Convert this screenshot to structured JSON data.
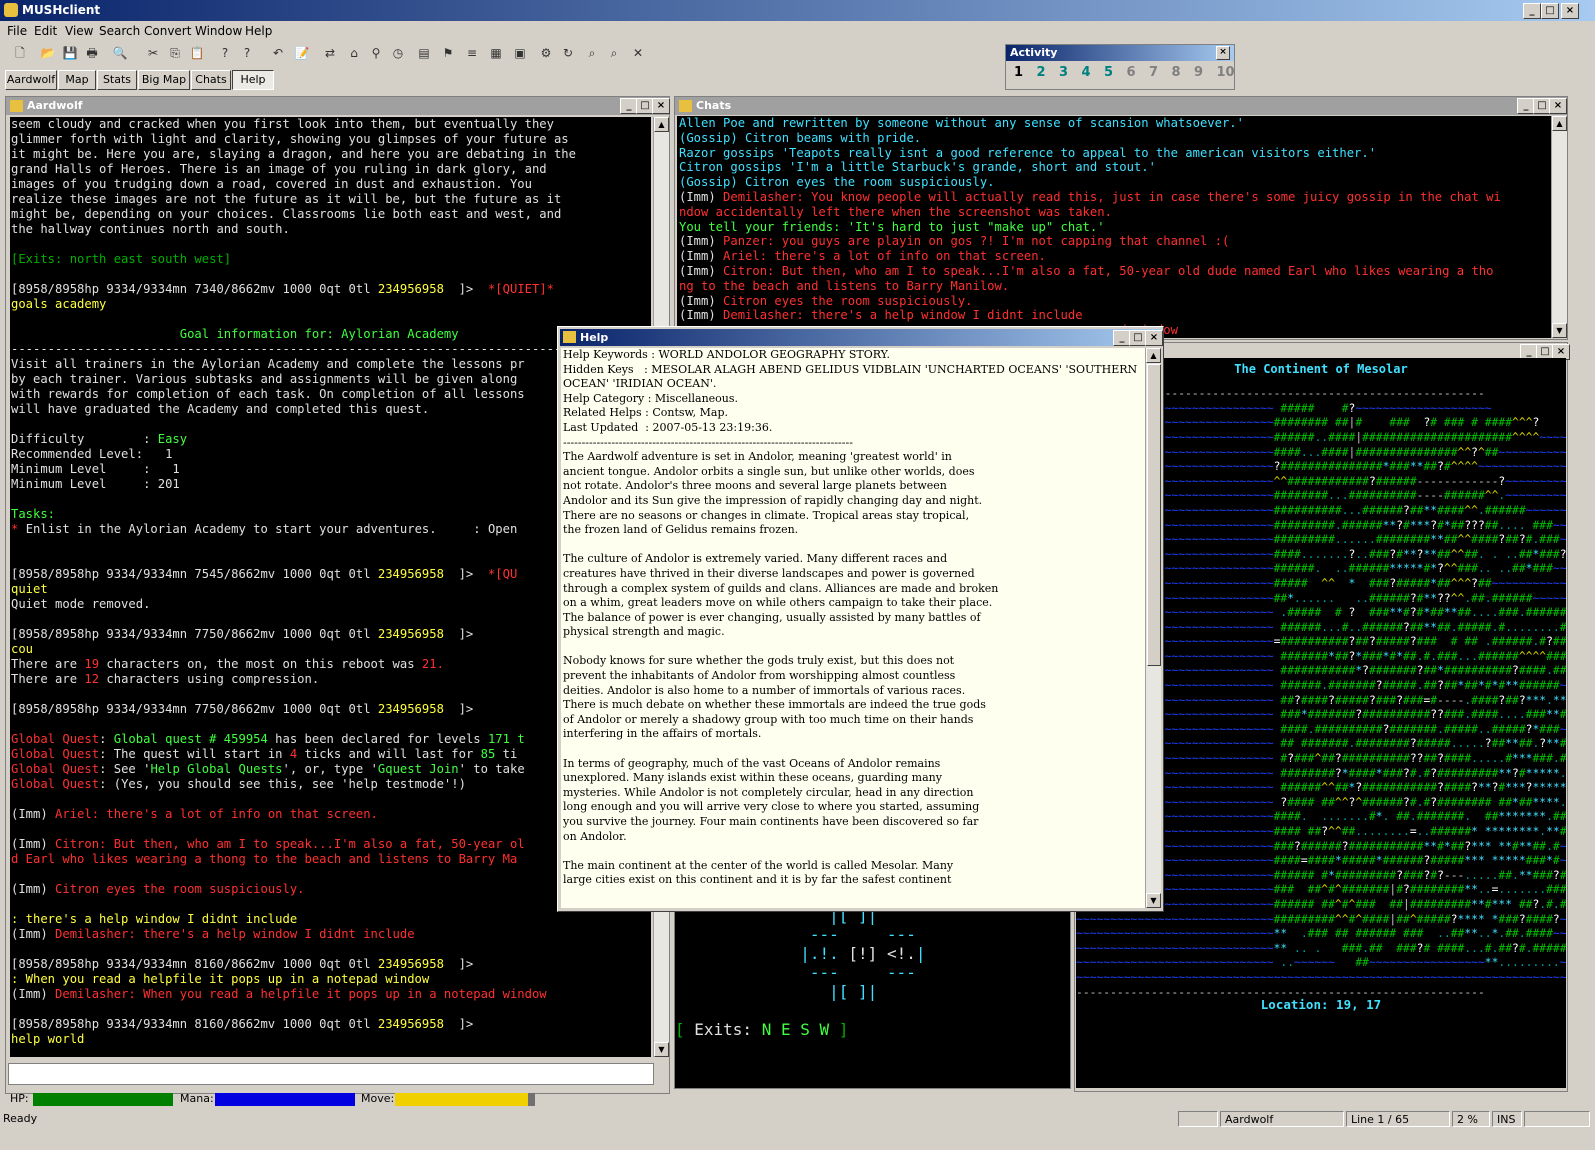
{
  "app": {
    "title": "MUSHclient"
  },
  "menu": [
    "File",
    "Edit",
    "View",
    "Search",
    "Convert",
    "Window",
    "Help"
  ],
  "toolbar": {
    "icons": [
      "new-icon",
      "open-icon",
      "save-icon",
      "print-icon",
      "print-preview-icon",
      "cut-icon",
      "copy-icon",
      "paste-icon",
      "help-icon",
      "context-help-icon",
      "undo-icon",
      "notepad-icon",
      "connect-icon",
      "world-icon",
      "link-icon",
      "timer-icon",
      "log-icon",
      "triggers-icon",
      "aliases-icon",
      "variables-icon",
      "plugins-icon",
      "scripts-icon",
      "reload-icon",
      "find-icon",
      "find-again-icon",
      "quit-icon"
    ]
  },
  "tabs": [
    "Aardwolf",
    "Map",
    "Stats",
    "Big Map",
    "Chats",
    "Help"
  ],
  "activity": {
    "title": "Activity",
    "numbers": [
      "1",
      "2",
      "3",
      "4",
      "5",
      "6",
      "7",
      "8",
      "9",
      "10"
    ]
  },
  "aardwolf_window": {
    "title": "Aardwolf"
  },
  "chats_window": {
    "title": "Chats"
  },
  "help_window": {
    "title": "Help"
  },
  "map_window": {
    "title": "The Continent of Mesolar",
    "location": "Location: 19, 17"
  },
  "roommap": {
    "exits_label": "[ Exits: ",
    "exits": "N E S W",
    "close": " ]"
  },
  "gauges": {
    "hp_label": "HP:",
    "mana_label": "Mana:",
    "move_label": "Move:",
    "hp": 1.0,
    "mana": 1.0,
    "move": 0.95
  },
  "statusbar": {
    "ready": "Ready",
    "world": "Aardwolf",
    "line": "Line 1 / 65",
    "percent": "2 %",
    "ins": "INS"
  },
  "main_lines": [
    [
      [
        "w",
        "seem cloudy and cracked when you first look into them, but eventually they"
      ]
    ],
    [
      [
        "w",
        "glimmer forth with light and clarity, showing you glimpses of your future as"
      ]
    ],
    [
      [
        "w",
        "it might be. Here you are, slaying a dragon, and here you are debating in the"
      ]
    ],
    [
      [
        "w",
        "grand Halls of Heroes. There is an image of you ruling in dark glory, and"
      ]
    ],
    [
      [
        "w",
        "images of you trudging down a road, covered in dust and exhaustion. You"
      ]
    ],
    [
      [
        "w",
        "realize these images are not the future as it will be, but the future as it"
      ]
    ],
    [
      [
        "w",
        "might be, depending on your choices. Classrooms lie both east and west, and"
      ]
    ],
    [
      [
        "w",
        "the hallway continues north and south."
      ]
    ],
    [
      [
        "w",
        ""
      ]
    ],
    [
      [
        "dg",
        "[Exits: north east south west]"
      ]
    ],
    [
      [
        "w",
        ""
      ]
    ],
    [
      [
        "w",
        "[8958/8958hp 9334/9334mn 7340/8662mv 1000 0qt 0tl "
      ],
      [
        "y",
        "234956958"
      ],
      [
        "w",
        "  ]>  "
      ],
      [
        "r",
        "*[QUIET]*"
      ]
    ],
    [
      [
        "y",
        "goals academy"
      ]
    ],
    [
      [
        "w",
        ""
      ]
    ],
    [
      [
        "g",
        "                       Goal information for: Aylorian Academy"
      ]
    ],
    [
      [
        "w",
        "------------------------------------------------------------------------------"
      ]
    ],
    [
      [
        "w",
        "Visit all trainers in the Aylorian Academy and complete the lessons pr"
      ]
    ],
    [
      [
        "w",
        "by each trainer. Various subtasks and assignments will be given along"
      ]
    ],
    [
      [
        "w",
        "with rewards for completion of each task. On completion of all lessons"
      ]
    ],
    [
      [
        "w",
        "will have graduated the Academy and completed this quest."
      ]
    ],
    [
      [
        "w",
        ""
      ]
    ],
    [
      [
        "w",
        "Difficulty        : "
      ],
      [
        "g",
        "Easy"
      ]
    ],
    [
      [
        "w",
        "Recommended Level:   1"
      ]
    ],
    [
      [
        "w",
        "Minimum Level     :   1"
      ]
    ],
    [
      [
        "w",
        "Minimum Level     : 201"
      ]
    ],
    [
      [
        "w",
        ""
      ]
    ],
    [
      [
        "g",
        "Tasks:"
      ]
    ],
    [
      [
        "r",
        "* "
      ],
      [
        "w",
        "Enlist in the Aylorian Academy to start your adventures.     : Open"
      ]
    ],
    [
      [
        "w",
        ""
      ]
    ],
    [
      [
        "w",
        ""
      ]
    ],
    [
      [
        "w",
        "[8958/8958hp 9334/9334mn 7545/8662mv 1000 0qt 0tl "
      ],
      [
        "y",
        "234956958"
      ],
      [
        "w",
        "  ]>  "
      ],
      [
        "r",
        "*[QU"
      ]
    ],
    [
      [
        "y",
        "quiet"
      ]
    ],
    [
      [
        "w",
        "Quiet mode removed."
      ]
    ],
    [
      [
        "w",
        ""
      ]
    ],
    [
      [
        "w",
        "[8958/8958hp 9334/9334mn 7750/8662mv 1000 0qt 0tl "
      ],
      [
        "y",
        "234956958"
      ],
      [
        "w",
        "  ]>"
      ]
    ],
    [
      [
        "y",
        "cou"
      ]
    ],
    [
      [
        "w",
        "There are "
      ],
      [
        "r",
        "19"
      ],
      [
        "w",
        " characters on, the most on this reboot was "
      ],
      [
        "r",
        "21."
      ]
    ],
    [
      [
        "w",
        "There are "
      ],
      [
        "r",
        "12"
      ],
      [
        "w",
        " characters using compression."
      ]
    ],
    [
      [
        "w",
        ""
      ]
    ],
    [
      [
        "w",
        "[8958/8958hp 9334/9334mn 7750/8662mv 1000 0qt 0tl "
      ],
      [
        "y",
        "234956958"
      ],
      [
        "w",
        "  ]>"
      ]
    ],
    [
      [
        "w",
        ""
      ]
    ],
    [
      [
        "r",
        "Global Quest"
      ],
      [
        "w",
        ": "
      ],
      [
        "g",
        "Global quest # 459954"
      ],
      [
        "w",
        " has been declared for levels "
      ],
      [
        "g",
        "171 t"
      ]
    ],
    [
      [
        "r",
        "Global Quest"
      ],
      [
        "w",
        ": The quest will start in "
      ],
      [
        "r",
        "4"
      ],
      [
        "w",
        " ticks and will last for "
      ],
      [
        "g",
        "85"
      ],
      [
        "w",
        " ti"
      ]
    ],
    [
      [
        "r",
        "Global Quest"
      ],
      [
        "w",
        ": See '"
      ],
      [
        "g",
        "Help Global Quests"
      ],
      [
        "w",
        "', or, type '"
      ],
      [
        "g",
        "Gquest Join"
      ],
      [
        "w",
        "' to take"
      ]
    ],
    [
      [
        "r",
        "Global Quest"
      ],
      [
        "w",
        ": (Yes, you should see this, see 'help testmode'!)"
      ]
    ],
    [
      [
        "w",
        ""
      ]
    ],
    [
      [
        "w",
        "("
      ],
      [
        "w",
        "Imm"
      ],
      [
        "w",
        ") "
      ],
      [
        "r",
        "Ariel: there's a lot of info on that screen."
      ]
    ],
    [
      [
        "w",
        ""
      ]
    ],
    [
      [
        "w",
        "(Imm) "
      ],
      [
        "r",
        "Citron: But then, who am I to speak...I'm also a fat, 50-year ol"
      ]
    ],
    [
      [
        "r",
        "d Earl who likes wearing a thong to the beach and listens to Barry Ma"
      ]
    ],
    [
      [
        "w",
        ""
      ]
    ],
    [
      [
        "w",
        "(Imm) "
      ],
      [
        "r",
        "Citron eyes the room suspiciously."
      ]
    ],
    [
      [
        "w",
        ""
      ]
    ],
    [
      [
        "y",
        ": there's a help window I didnt include"
      ]
    ],
    [
      [
        "w",
        "(Imm) "
      ],
      [
        "r",
        "Demilasher: there's a help window I didnt include"
      ]
    ],
    [
      [
        "w",
        ""
      ]
    ],
    [
      [
        "w",
        "[8958/8958hp 9334/9334mn 8160/8662mv 1000 0qt 0tl "
      ],
      [
        "y",
        "234956958"
      ],
      [
        "w",
        "  ]>"
      ]
    ],
    [
      [
        "y",
        ": When you read a helpfile it pops up in a notepad window"
      ]
    ],
    [
      [
        "w",
        "(Imm) "
      ],
      [
        "r",
        "Demilasher: When you read a helpfile it pops up in a notepad window"
      ]
    ],
    [
      [
        "w",
        ""
      ]
    ],
    [
      [
        "w",
        "[8958/8958hp 9334/9334mn 8160/8662mv 1000 0qt 0tl "
      ],
      [
        "y",
        "234956958"
      ],
      [
        "w",
        "  ]>"
      ]
    ],
    [
      [
        "y",
        "help world"
      ]
    ],
    [
      [
        "w",
        ""
      ]
    ],
    [
      [
        "w",
        "[8958/8958hp 9334/9334mn 8160/8662mv 1000 0qt 0tl "
      ],
      [
        "y",
        "234956958"
      ],
      [
        "w",
        "  ]>"
      ]
    ]
  ],
  "chat_lines": [
    [
      [
        "c",
        "Allen Poe and rewritten by someone without any sense of scansion whatsoever.'"
      ]
    ],
    [
      [
        "c",
        "(Gossip) Citron beams with pride."
      ]
    ],
    [
      [
        "c",
        "Razor gossips 'Teapots really isnt a good reference to appeal to the american visitors either.'"
      ]
    ],
    [
      [
        "c",
        "Citron gossips 'I'm a little Starbuck's grande, short and stout.'"
      ]
    ],
    [
      [
        "c",
        "(Gossip) Citron eyes the room suspiciously."
      ]
    ],
    [
      [
        "w",
        "("
      ],
      [
        "w",
        "Imm"
      ],
      [
        "w",
        ") "
      ],
      [
        "r",
        "Demilasher: You know people will actually read this, just in case there's some juicy gossip in the chat wi"
      ]
    ],
    [
      [
        "r",
        "ndow accidentally left there when the screenshot was taken."
      ]
    ],
    [
      [
        "g",
        "You tell your friends: 'It's hard to just \"make up\" chat.'"
      ]
    ],
    [
      [
        "w",
        "(Imm) "
      ],
      [
        "r",
        "Panzer: you guys are playin on gos ?! I'm not capping that channel :("
      ]
    ],
    [
      [
        "w",
        "(Imm) "
      ],
      [
        "r",
        "Ariel: there's a lot of info on that screen."
      ]
    ],
    [
      [
        "w",
        "(Imm) "
      ],
      [
        "r",
        "Citron: But then, who am I to speak...I'm also a fat, 50-year old dude named Earl who likes wearing a tho"
      ]
    ],
    [
      [
        "r",
        "ng to the beach and listens to Barry Manilow."
      ]
    ],
    [
      [
        "w",
        "(Imm) "
      ],
      [
        "r",
        "Citron eyes the room suspiciously."
      ]
    ],
    [
      [
        "w",
        "(Imm) "
      ],
      [
        "r",
        "Demilasher: there's a help window I didnt include"
      ]
    ],
    [
      [
        "r",
        "                                                          pad window"
      ]
    ]
  ],
  "help_lines": [
    "Help Keywords : WORLD ANDOLOR GEOGRAPHY STORY.",
    "Hidden Keys   : MESOLAR ALAGH ABEND GELIDUS VIDBLAIN 'UNCHARTED OCEANS' 'SOUTHERN",
    "OCEAN' 'IRIDIAN OCEAN'.",
    "Help Category : Miscellaneous.",
    "Related Helps : Contsw, Map.",
    "Last Updated  : 2007-05-13 23:19:36.",
    "------------------------------------------------------------------------------",
    "The Aardwolf adventure is set in Andolor, meaning 'greatest world' in",
    "ancient tongue. Andolor orbits a single sun, but unlike other worlds, does",
    "not rotate. Andolor's three moons and several large planets between",
    "Andolor and its Sun give the impression of rapidly changing day and night.",
    "There are no seasons or changes in climate. Tropical areas stay tropical,",
    "the frozen land of Gelidus remains frozen.",
    "",
    "The culture of Andolor is extremely varied. Many different races and",
    "creatures have thrived in their diverse landscapes and power is governed",
    "through a complex system of guilds and clans. Alliances are made and broken",
    "on a whim, great leaders move on while others campaign to take their place.",
    "The balance of power is ever changing, usually assisted by many battles of",
    "physical strength and magic.",
    "",
    "Nobody knows for sure whether the gods truly exist, but this does not",
    "prevent the inhabitants of Andolor from worshipping almost countless",
    "deities. Andolor is also home to a number of immortals of various races.",
    "There is much debate on whether these immortals are indeed the true gods",
    "of Andolor or merely a shadowy group with too much time on their hands",
    "interfering in the affairs of mortals.",
    "",
    "In terms of geography, much of the vast Oceans of Andolor remains",
    "unexplored. Many islands exist within these oceans, guarding many",
    "mysteries. While Andolor is not completely circular, head in any direction",
    "long enough and you will arrive very close to where you started, assuming",
    "you survive the journey. Four main continents have been discovered so far",
    "on Andolor.",
    "",
    "The main continent at the center of the world is called Mesolar. Many",
    "large cities exist on this continent and it is by far the safest continent"
  ],
  "map_lines": [
    "------------------------------------------------------------",
    "~~~~~~~~~~~~~~~~~~~~~~~~~~~~~ #####    #?~~~~~~~~~~~~~~~~~~~~",
    "~~~~~~~~~~~~~~~~~~~~~~~~~~~~~######## ##|#    ###  ?# ### # ####^^^?       ?",
    "~~~~~~~~~~~~~~~~~~~~~~~~~~~~~######..####|######################^^^^~~~~~~~~",
    "~~~~~~~~~~~~~~~~~~~~~~~~~~~~~####...####|###############^^?^##~~~~~~~~~~~~~~",
    "~~~~~~~~~~~~~~~~~~~~~~~~~~~~~?###############*###**##?#^^^^~~~~~~~~~~~~~~~~~",
    "~~~~~~~~~~~~~~~~~~~~~~~~~~~~~^^############?######------------?~~~~~~~~~~~~",
    "~~~~~~~~~~~~~~~~~~~~~~~~~~~~~########...##########----######^^.~~~~~~~~~~~~",
    "~~~~~~~~~~~~~~~~~~~~~~~~~~~~~##########...######?##**####^^.######~~~~~~~~~",
    "~~~~~~~~~~~~~~~~~~~~~~~~~~~~~#########.######**?#***?#*##???##.... ###~~~~~",
    "~~~~~~~~~~~~~~~~~~~~~~~~~~~~~#########......########**##^^####?##?#.###~~~~",
    "~~~~~~~~~~~~~~~~~~~~~~~~~~~~~####.......?..###?#**?**##^^##. . ..##*###?~~~",
    "~~~~~~~~~~~~~~~~~~~~~~~~~~~~~######.  ..######*****#*?^^###.. ..##*###~~~~~",
    "~~~~~~~~~~~~~~~~~~~~~~~~~~~~~#####  ^^  *  ###?#####*##^^^?##~~~~~~~~~~~~~~",
    "~~~~~~~~~~~~~~~~~~~~~~~~~~~~~##*......   ..######?#**??^^.##.######~~~~~~~~",
    "~~~~~~~~~~~~~~~~~~~~~~~~~~~~~ .#####  # ?  ###**#?#*##**##....###.#########",
    "~~~~~~~~~~~~~~~~~~~~~~~~~~~~~ ######...#..######?##**##.#####.#........####",
    "~~~~~~~~~~~~~~~~~~~~~~~~~~~~~=##########?##?#####?###  # ## .######.#?##^~~",
    "~~~~~~~~~~~~~~~~~~~~~~~~~~~~~ #######*##?*###*#*##.#.###...######^^^^####~~",
    "~~~~~~~~~~~~~~~~~~~~~~~~~~~~~ ###########*?#######?##*##########?####.##~~~",
    "~~~~~~~~~~~~~~~~~~~~~~~~~~~~~ ######.#######?#####.##?##*##*#*#**######~~~~",
    "~~~~~~~~~~~~~~~~~~~~~~~~~~~~~ ##?####?#####?###?###=#----.####?##?***.**?~~",
    "~~~~~~~~~~~~~~~~~~~~~~~~~~~~~ ###*#######?##########??###.####....###**#~~~",
    "~~~~~~~~~~~~~~~~~~~~~~~~~~~~~ ####.##########?#######.#####..#####?*###~~~~",
    "~~~~~~~~~~~~~~~~~~~~~~~~~~~~~ ## #######.########?#####.....?##**##.?**##~~",
    "~~~~~~~~~~~~~~~~~~~~~~~~~~~~~ #?###^##?##########??##?####.....#***###.###~",
    "~~~~~~~~~~~~~~~~~~~~~~~~~~~~~ ########?*####*###?#.#?#########**?#*****.**#",
    "~~~~~~~~~~~~~~~~~~~~~~~~~~~~~ ######^^##*?###########?####?**?#***?*****.*##",
    "~~~~~~~~~~~~~~~~~~~~~~~~~~~~~ ?#### ##^^?^######?#.#?######## ##*##****.*?#",
    "~~~~~~~~~~~~~~~~~~~~~~~~~~~~~####.  .......#*. ##.#######.  ##*******.##~~",
    "~~~~~~~~~~~~~~~~~~~~~~~~~~~~~#### ##?^^##........=..######* ********.**#~~",
    "~~~~~~~~~~~~~~~~~~~~~~~~~~~~~###?######?###########**#*##?*** **#**##.#~~~",
    "~~~~~~~~~~~~~~~~~~~~~~~~~~~~~####=####*#####*######?#####*** *****###*#~~~",
    "~~~~~~~~~~~~~~~~~~~~~~~~~~~~~###### #*#########?###?#?---.....##.**###?#~~",
    "~~~~~~~~~~~~~~~~~~~~~~~~~~~~~###  ##^#^#######|#?########**..=.......###~~",
    "~~~~~~~~~~~~~~~~~~~~~~~~~~~~~###### ##^#^###  ##|#########**#*** ##?.#.###",
    "~~~~~~~~~~~~~~~~~~~~~~~~~~~~~#########^^#^####|##^#####?**** *###?####?~~~",
    "~~~~~~~~~~~~~~~~~~~~~~~~~~~~~**  .### ## ###### ###  ..##**..*.##.####~~~~",
    "~~~~~~~~~~~~~~~~~~~~~~~~~~~~~** .. .   ###.##  ###?# ####...#.##?#.#####?#",
    "~~~~~~~~~~~~~~~~~~~~~~~~~~~~~ ..~~~~~~   ##~~~~~~~~~~~~~~~~~**.........~~~",
    "~~~~~~~~~~~~~~~~~~~~~~~~~~~~~~~~~~~~~~~~~~~~~~~~~~~~~~~~~~~~~~~~~~~~~~~~~~",
    "------------------------------------------------------------"
  ]
}
